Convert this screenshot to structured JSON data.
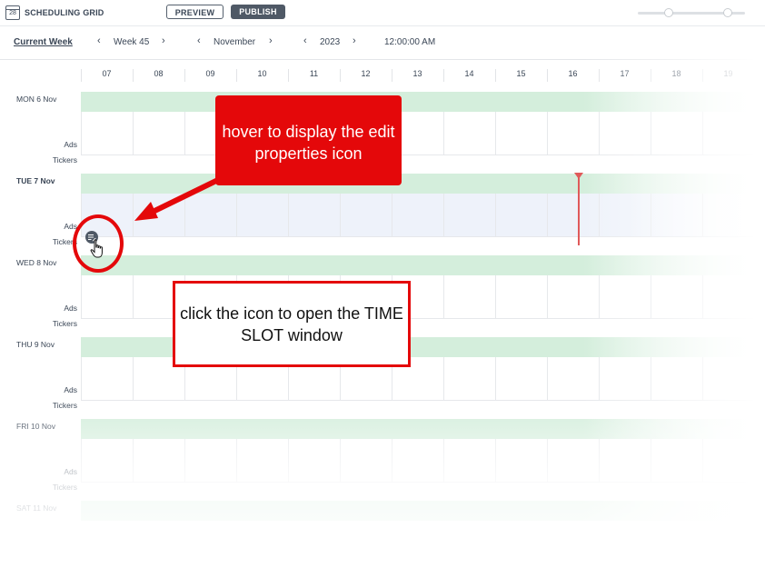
{
  "header": {
    "app_title": "SCHEDULING GRID",
    "calendar_day": "28",
    "preview_label": "PREVIEW",
    "publish_label": "PUBLISH"
  },
  "nav": {
    "current_week_label": "Current Week",
    "week_value": "Week 45",
    "month_value": "November",
    "year_value": "2023",
    "time_value": "12:00:00 AM"
  },
  "hours": [
    "07",
    "08",
    "09",
    "10",
    "11",
    "12",
    "13",
    "14",
    "15",
    "16",
    "17",
    "18",
    "19"
  ],
  "days": [
    {
      "label": "MON 6 Nov",
      "ads": "Ads",
      "tickers": "Tickers"
    },
    {
      "label": "TUE 7 Nov",
      "ads": "Ads",
      "tickers": "Tickers"
    },
    {
      "label": "WED 8 Nov",
      "ads": "Ads",
      "tickers": "Tickers"
    },
    {
      "label": "THU 9 Nov",
      "ads": "Ads",
      "tickers": "Tickers"
    },
    {
      "label": "FRI 10 Nov",
      "ads": "Ads",
      "tickers": "Tickers"
    },
    {
      "label": "SAT 11 Nov"
    }
  ],
  "annotations": {
    "hover_note": "hover to display the edit properties icon",
    "click_note": "click the icon to open the TIME SLOT window"
  },
  "colors": {
    "accent_red": "#e4080a",
    "lane_green": "#d4eedc",
    "selected_row": "#eef2fa",
    "now_line": "#e05a5a"
  },
  "icons": {
    "calendar": "calendar-icon",
    "edit_properties": "edit-properties-icon",
    "cursor": "hand-pointer-icon"
  }
}
